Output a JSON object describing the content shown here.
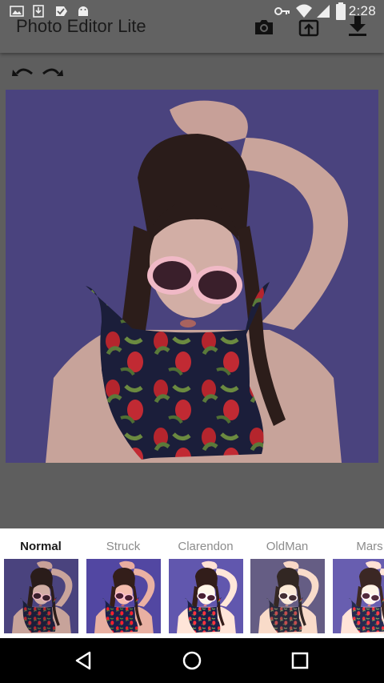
{
  "status_bar": {
    "time": "2:28",
    "left_icons": [
      "image-icon",
      "download-notification-icon",
      "check-notification-icon",
      "android-icon"
    ],
    "right_icons": [
      "vpn-key-icon",
      "wifi-icon",
      "signal-icon",
      "battery-icon"
    ]
  },
  "app_bar": {
    "title": "Photo Editor Lite",
    "actions": [
      "camera-icon",
      "upload-icon",
      "download-icon"
    ]
  },
  "history": {
    "undo_icon": "undo-icon",
    "redo_icon": "redo-icon"
  },
  "filters": [
    {
      "label": "Normal",
      "active": true
    },
    {
      "label": "Struck",
      "active": false
    },
    {
      "label": "Clarendon",
      "active": false
    },
    {
      "label": "OldMan",
      "active": false
    },
    {
      "label": "Mars",
      "active": false
    }
  ],
  "nav_bar": {
    "icons": [
      "back-icon",
      "home-icon",
      "recents-icon"
    ]
  },
  "colors": {
    "overlay_bar": "#626262",
    "photo_background": "#4a437e",
    "strip_background": "#ffffff",
    "active_filter_text": "#1b1b1b",
    "inactive_filter_text": "#8c8c8c"
  }
}
